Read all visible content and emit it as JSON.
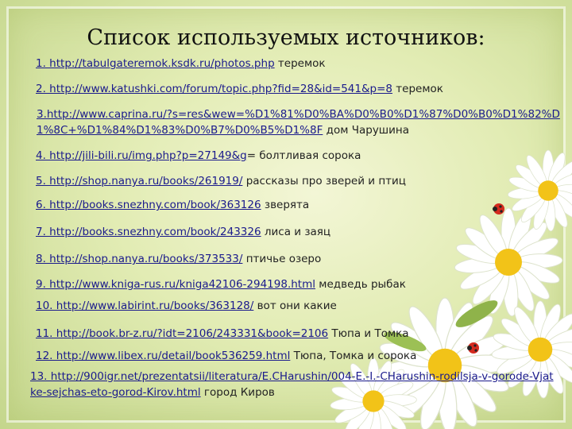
{
  "title": "Список используемых источников:",
  "sources": [
    {
      "link": "1. http://tabulgateremok.ksdk.ru/photos.php",
      "desc": " теремок"
    },
    {
      "link": "2. http://www.katushki.com/forum/topic.php?fid=28&id=541&p=8",
      "desc": " теремок"
    },
    {
      "link": "3.http://www.caprina.ru/?s=res&wew=%D1%81%D0%BA%D0%B0%D1%87%D0%B0%D1%82%D1%8C+%D1%84%D1%83%D0%B7%D0%B5%D1%8F",
      "desc": " дом Чарушина"
    },
    {
      "link": "4. http://jili-bili.ru/img.php?p=27149&g",
      "desc": "= болтливая сорока"
    },
    {
      "link": "5. http://shop.nanya.ru/books/261919/",
      "desc": " рассказы про зверей и птиц"
    },
    {
      "link": "6. http://books.snezhny.com/book/363126",
      "desc": " зверята"
    },
    {
      "link": "7. http://books.snezhny.com/book/243326",
      "desc": " лиса и заяц"
    },
    {
      "link": "8. http://shop.nanya.ru/books/373533/",
      "desc": " птичье озеро"
    },
    {
      "link": "9. http://www.kniga-rus.ru/kniga42106-294198.html",
      "desc": " медведь рыбак"
    },
    {
      "link": "10. http://www.labirint.ru/books/363128/",
      "desc": " вот они какие"
    },
    {
      "link": "11. http://book.br-z.ru/?idt=2106/243331&book=2106",
      "desc": " Тюпа и Томка"
    },
    {
      "link": "12. http://www.libex.ru/detail/book536259.html",
      "desc": " Тюпа, Томка и сорока"
    },
    {
      "link": "13. http://900igr.net/prezentatsii/literatura/E.CHarushin/004-E.-I.-CHarushin-rodilsja-v-gorode-Vjatke-sejchas-eto-gorod-Kirov.html",
      "desc": " город Киров"
    }
  ]
}
